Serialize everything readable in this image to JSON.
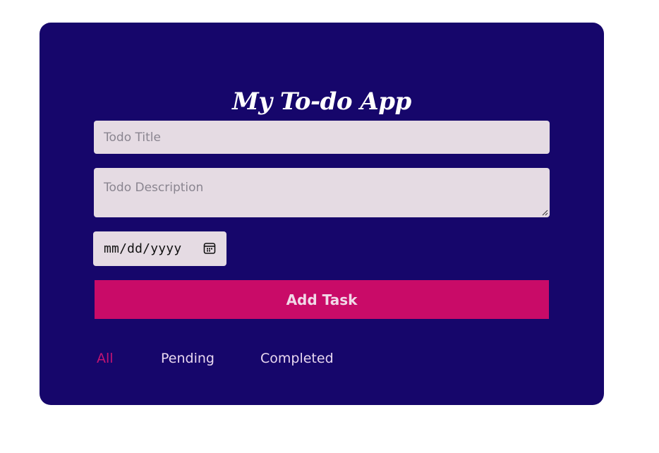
{
  "app": {
    "title": "My To-do App"
  },
  "form": {
    "title_placeholder": "Todo Title",
    "title_value": "",
    "description_placeholder": "Todo Description",
    "description_value": "",
    "date_placeholder": "mm/dd/yyyy",
    "date_icon": "calendar-icon",
    "add_button_label": "Add Task"
  },
  "filters": {
    "items": [
      {
        "label": "All",
        "active": true
      },
      {
        "label": "Pending",
        "active": false
      },
      {
        "label": "Completed",
        "active": false
      }
    ]
  },
  "colors": {
    "page_background": "#ffffff",
    "card_background": "#16066b",
    "input_background": "#e5dbe3",
    "button_background": "#c90b68",
    "button_text": "#f1d9e8",
    "active_filter": "#c21473",
    "inactive_filter": "#e9d8f0"
  }
}
